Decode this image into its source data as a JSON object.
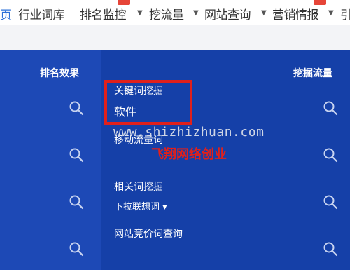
{
  "nav": {
    "items": [
      {
        "label": "页",
        "active": true
      },
      {
        "label": "行业词库"
      },
      {
        "label": "排名监控",
        "caret": true,
        "hot": true
      },
      {
        "label": "挖流量",
        "caret": true
      },
      {
        "label": "网站查询",
        "caret": true
      },
      {
        "label": "营销情报",
        "caret": true,
        "hot": true
      },
      {
        "label": "引"
      }
    ]
  },
  "left_panel": {
    "header": "排名效果"
  },
  "right_panel": {
    "header": "挖掘流量",
    "items": [
      {
        "label_line1": "关键词挖掘",
        "label_line2": "软件"
      },
      {
        "label_line1": "移动流量词"
      },
      {
        "label_line1": "相关词挖掘",
        "label_line2": "下拉联想词 ▾"
      },
      {
        "label_line1": "网站竞价词查询"
      }
    ]
  },
  "overlay": {
    "watermark": "www.shizhizhuan.com",
    "red_label": "飞翔网络创业"
  },
  "colors": {
    "panel_left": "#1d49b6",
    "panel_right": "#1540a8",
    "highlight": "#e0201c",
    "nav_active": "#2a6fd8"
  }
}
